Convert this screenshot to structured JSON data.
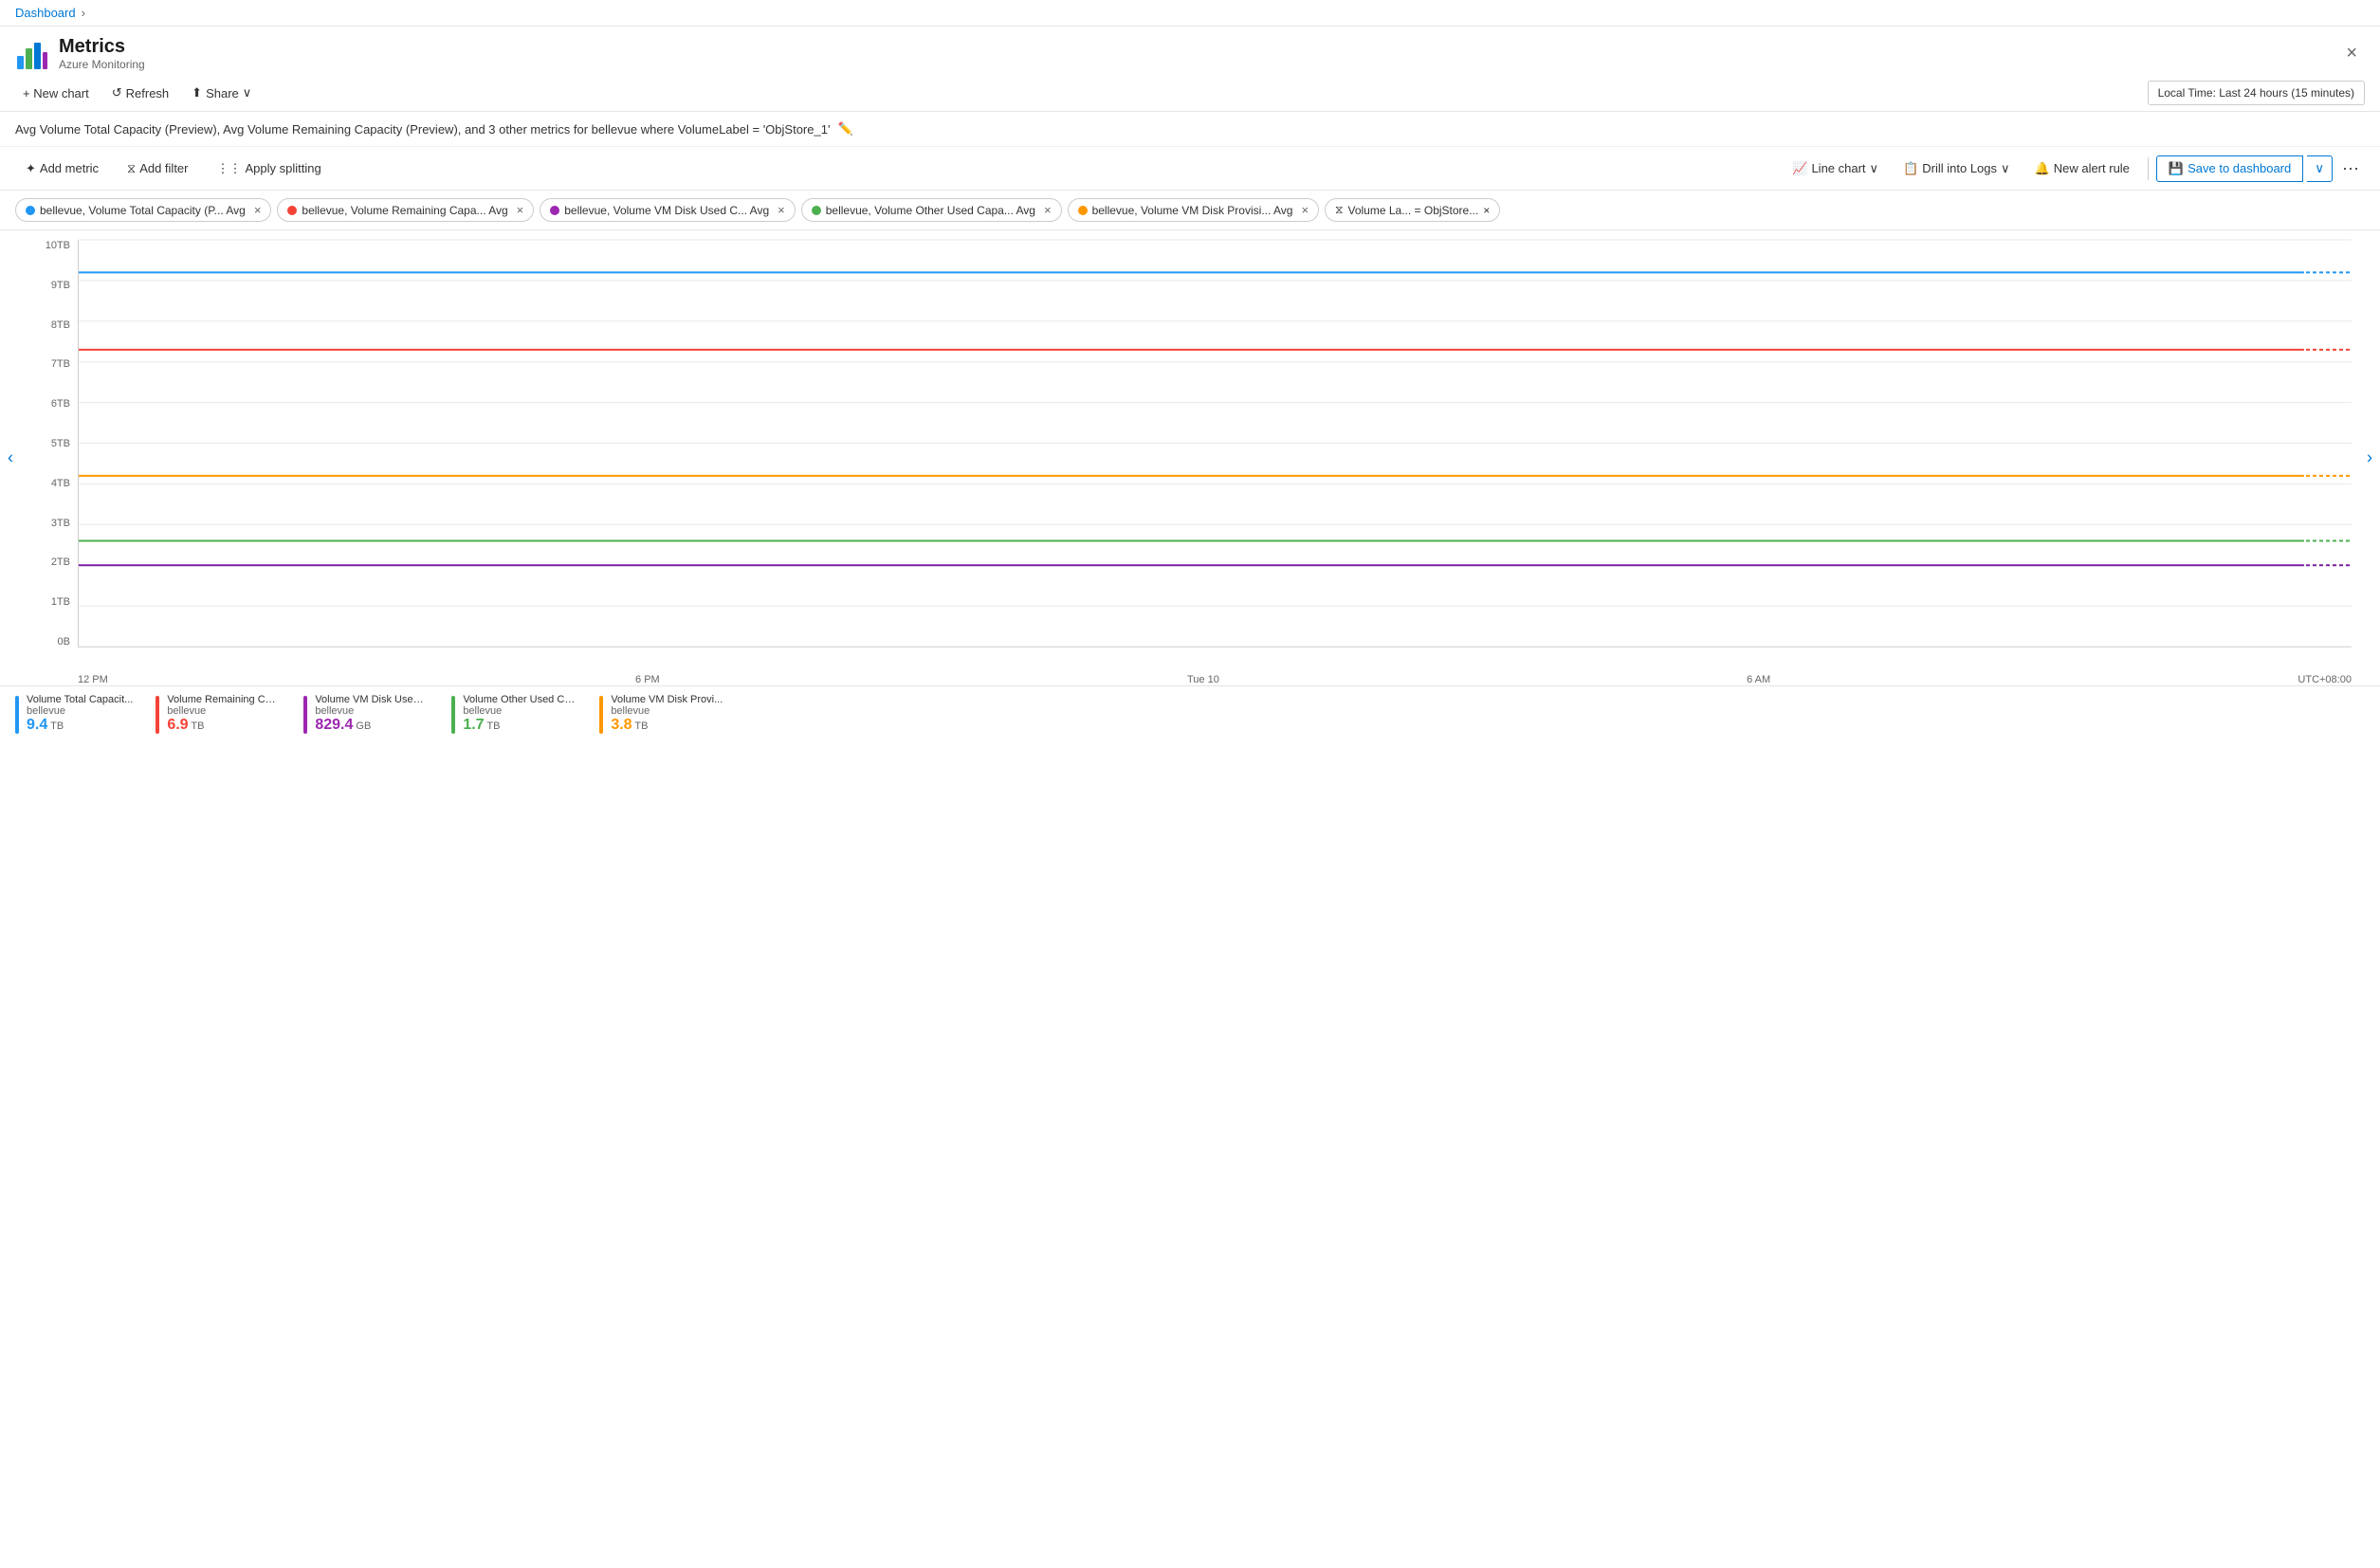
{
  "breadcrumb": {
    "label": "Dashboard",
    "sep": "›"
  },
  "header": {
    "title": "Metrics",
    "subtitle": "Azure Monitoring",
    "close_label": "×"
  },
  "toolbar": {
    "new_chart": "+ New chart",
    "refresh": "Refresh",
    "share": "Share",
    "share_chevron": "∨",
    "time_selector": "Local Time: Last 24 hours (15 minutes)"
  },
  "chart_title": "Avg Volume Total Capacity (Preview), Avg Volume Remaining Capacity (Preview), and 3 other metrics for bellevue where VolumeLabel = 'ObjStore_1'",
  "chart_toolbar": {
    "add_metric": "Add metric",
    "add_filter": "Add filter",
    "apply_splitting": "Apply splitting",
    "line_chart": "Line chart",
    "drill_into_logs": "Drill into Logs",
    "new_alert_rule": "New alert rule",
    "save_to_dashboard": "Save to dashboard",
    "more": "···"
  },
  "pills": [
    {
      "id": "p1",
      "color": "#2196F3",
      "text": "bellevue, Volume Total Capacity (P... Avg"
    },
    {
      "id": "p2",
      "color": "#F44336",
      "text": "bellevue, Volume Remaining Capa... Avg"
    },
    {
      "id": "p3",
      "color": "#9C27B0",
      "text": "bellevue, Volume VM Disk Used C... Avg"
    },
    {
      "id": "p4",
      "color": "#4CAF50",
      "text": "bellevue, Volume Other Used Capa... Avg"
    },
    {
      "id": "p5",
      "color": "#FF9800",
      "text": "bellevue, Volume VM Disk Provisi... Avg"
    }
  ],
  "filter_pill": {
    "text": "Volume La... = ObjStore..."
  },
  "chart": {
    "y_labels": [
      "10TB",
      "9TB",
      "8TB",
      "7TB",
      "6TB",
      "5TB",
      "4TB",
      "3TB",
      "2TB",
      "1TB",
      "0B"
    ],
    "x_labels": [
      "12 PM",
      "6 PM",
      "Tue 10",
      "6 AM",
      "UTC+08:00"
    ],
    "lines": [
      {
        "color": "#2196F3",
        "top_pct": 8,
        "dashed_color": "#2196F3"
      },
      {
        "color": "#F44336",
        "top_pct": 27,
        "dashed_color": "#F44336"
      },
      {
        "color": "#FF9800",
        "top_pct": 60,
        "dashed_color": "#FF9800"
      },
      {
        "color": "#4CAF50",
        "top_pct": 76,
        "dashed_color": "#4CAF50"
      },
      {
        "color": "#7B1FA2",
        "top_pct": 82,
        "dashed_color": "#7B1FA2"
      }
    ]
  },
  "legend": [
    {
      "id": "l1",
      "color": "#2196F3",
      "title": "Volume Total Capacit...",
      "subtitle": "bellevue",
      "value": "9.4",
      "unit": "TB"
    },
    {
      "id": "l2",
      "color": "#F44336",
      "title": "Volume Remaining Cap...",
      "subtitle": "bellevue",
      "value": "6.9",
      "unit": "TB"
    },
    {
      "id": "l3",
      "color": "#9C27B0",
      "title": "Volume VM Disk Used ...",
      "subtitle": "bellevue",
      "value": "829.4",
      "unit": "GB"
    },
    {
      "id": "l4",
      "color": "#4CAF50",
      "title": "Volume Other Used Ca...",
      "subtitle": "bellevue",
      "value": "1.7",
      "unit": "TB"
    },
    {
      "id": "l5",
      "color": "#FF9800",
      "title": "Volume VM Disk Provi...",
      "subtitle": "bellevue",
      "value": "3.8",
      "unit": "TB"
    }
  ]
}
